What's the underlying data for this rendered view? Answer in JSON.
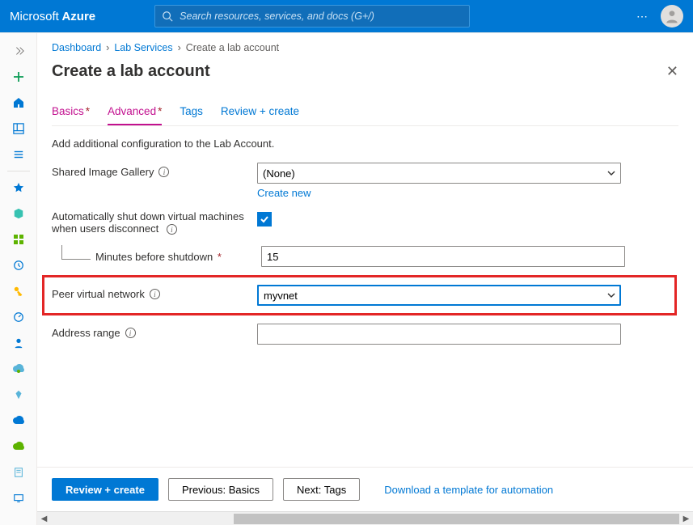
{
  "header": {
    "brand_ms": "Microsoft",
    "brand_az": "Azure",
    "search_placeholder": "Search resources, services, and docs (G+/)"
  },
  "breadcrumb": {
    "items": [
      "Dashboard",
      "Lab Services"
    ],
    "current": "Create a lab account"
  },
  "page": {
    "title": "Create a lab account"
  },
  "tabs": {
    "basics": "Basics",
    "advanced": "Advanced",
    "tags": "Tags",
    "review": "Review + create"
  },
  "form": {
    "description": "Add additional configuration to the Lab Account.",
    "shared_gallery_label": "Shared Image Gallery",
    "shared_gallery_value": "(None)",
    "create_new": "Create new",
    "auto_shutdown_label": "Automatically shut down virtual machines when users disconnect",
    "minutes_label": "Minutes before shutdown",
    "minutes_value": "15",
    "peer_label": "Peer virtual network",
    "peer_value": "myvnet",
    "address_label": "Address range",
    "address_value": ""
  },
  "footer": {
    "review": "Review + create",
    "prev": "Previous: Basics",
    "next": "Next: Tags",
    "download": "Download a template for automation"
  }
}
